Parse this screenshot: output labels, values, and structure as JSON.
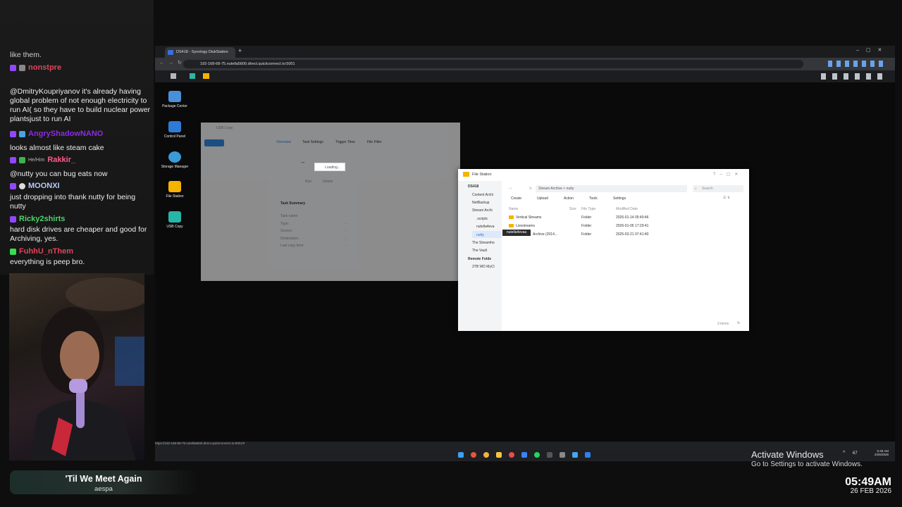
{
  "chat": {
    "top_text": "like them.",
    "messages": [
      {
        "user": "nonstpre",
        "user_color": "#e0445a",
        "text": ""
      },
      {
        "user": "",
        "user_color": "",
        "text": "@DmitryKoupriyanov it's already having global problem of not enough electricity to run AI( so they have to build nuclear power plantsjust to run AI"
      },
      {
        "user": "AngryShadowNANO",
        "user_color": "#8a2be2",
        "text": "looks almost like steam cake"
      },
      {
        "user": "Rakkir_",
        "user_color": "#ff5b8a",
        "pronoun": "He/Him",
        "text": "@nutty you can bug eats now"
      },
      {
        "user": "MOONXI",
        "user_color": "#b9c9ff",
        "text": "just dropping into thank nutty for being nutty"
      },
      {
        "user": "Ricky2shirts",
        "user_color": "#4fd16b",
        "text": "hard disk drives are cheaper and good for Archiving, yes."
      },
      {
        "user": "FuhhU_nThem",
        "user_color": "#e0445a",
        "text": "everything is peep bro."
      }
    ]
  },
  "browser": {
    "tab_title": "DS418 - Synology DiskStation",
    "url": "192-168-68-75.nutella5600.direct.quickconnect.to:5001",
    "status_url": "https://192-168-68-75.nutella5600.direct.quickconnect.to:5001/#"
  },
  "desktop": {
    "icons": [
      {
        "label": "Package Center",
        "color": "#4a90d9"
      },
      {
        "label": "Control Panel",
        "color": "#2e7bd6"
      },
      {
        "label": "Storage Manager",
        "color": "#3a9bd9"
      },
      {
        "label": "File Station",
        "color": "#f5b400"
      },
      {
        "label": "USB Copy",
        "color": "#27b5a8"
      }
    ]
  },
  "usb_copy": {
    "title": "USB Copy",
    "tabs": [
      "Overview",
      "Task Settings",
      "Trigger Time",
      "File Filter"
    ],
    "task_title": "--",
    "btn_run": "Run",
    "btn_delete": "Delete",
    "summary_title": "Task Summary",
    "loading": "Loading...",
    "fields": [
      "Task name:",
      "Type:",
      "Source:",
      "Destination:",
      "Last copy time:"
    ],
    "field_values": [
      "-",
      "-",
      "-",
      "-",
      "-"
    ]
  },
  "file_station": {
    "title": "File Station",
    "tree_root": "DS418",
    "tree": [
      "Content Archi",
      "NetBackup",
      "Stream Archi",
      ".scripts",
      "nutella4eva",
      "nutty",
      "The Streamho",
      "The Vault"
    ],
    "remote_title": "Remote Folde",
    "remote_items": [
      "3TB WD MyCl"
    ],
    "path": "Stream Archive > nutty",
    "search_placeholder": "Search",
    "toolbar": [
      "Create",
      "Upload",
      "Action",
      "Tools",
      "Settings"
    ],
    "columns": [
      "Name",
      "Size",
      "File Type",
      "Modified Date"
    ],
    "rows": [
      {
        "name": "Vertical Streams",
        "size": "",
        "type": "Folder",
        "date": "2026-01-14 05:49:46"
      },
      {
        "name": "Livestreams",
        "size": "",
        "type": "Folder",
        "date": "2026-01-05 17:29:41"
      },
      {
        "name": "Archive (2014...",
        "size": "",
        "type": "Folder",
        "date": "2025-02-21 07:41:40"
      }
    ],
    "tooltip": "nutella4evaa",
    "item_count": "3 items"
  },
  "windows": {
    "activate_title": "Activate Windows",
    "activate_sub": "Go to Settings to activate Windows.",
    "tray_time": "5:49 AM",
    "tray_date": "2/26/2026",
    "tray_temp": "67"
  },
  "song": {
    "title": "'Til We Meet Again",
    "artist": "aespa"
  },
  "clock": {
    "time": "05:49AM",
    "date": "26 FEB 2026"
  }
}
